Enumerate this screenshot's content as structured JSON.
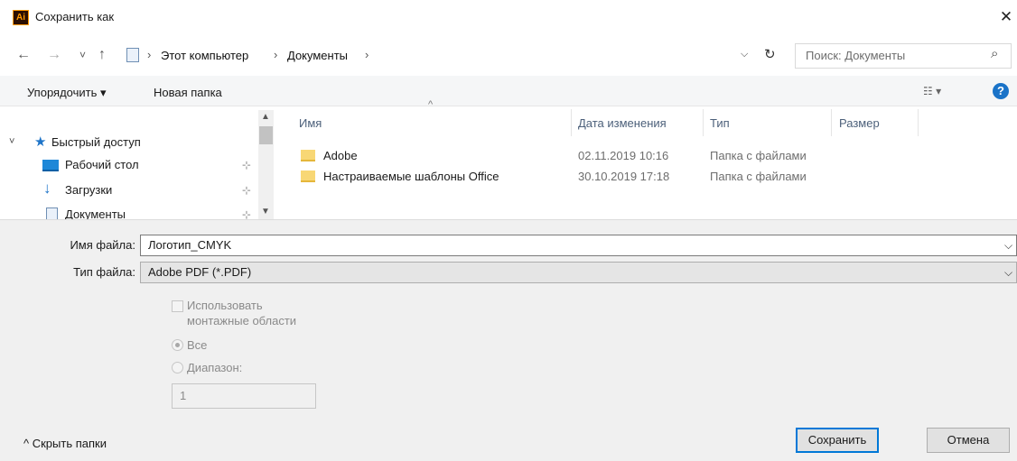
{
  "window": {
    "app_icon_text": "Ai",
    "title": "Сохранить как",
    "close_glyph": "✕"
  },
  "nav": {
    "back_glyph": "←",
    "forward_glyph": "→",
    "recent_glyph": "˅",
    "up_glyph": "↑",
    "breadcrumb": [
      "Этот компьютер",
      "Документы"
    ],
    "separator": "›",
    "refresh_glyph": "↻",
    "search_placeholder": "Поиск: Документы",
    "search_glyph": "⌕"
  },
  "toolbar": {
    "organize_label": "Упорядочить ▾",
    "new_folder_label": "Новая папка",
    "view_glyph": "☷ ▾",
    "help_glyph": "?"
  },
  "sidebar": {
    "items": [
      {
        "label": "Быстрый доступ",
        "icon": "star-icon",
        "pinned": false
      },
      {
        "label": "Рабочий стол",
        "icon": "desktop-icon",
        "pinned": true
      },
      {
        "label": "Загрузки",
        "icon": "download-icon",
        "pinned": true
      },
      {
        "label": "Документы",
        "icon": "documents-icon",
        "pinned": true
      }
    ],
    "pin_glyph": "📌"
  },
  "file_list": {
    "sort_glyph": "^",
    "columns": [
      "Имя",
      "Дата изменения",
      "Тип",
      "Размер"
    ],
    "rows": [
      {
        "name": "Adobe",
        "date": "02.11.2019 10:16",
        "type": "Папка с файлами",
        "size": ""
      },
      {
        "name": "Настраиваемые шаблоны Office",
        "date": "30.10.2019 17:18",
        "type": "Папка с файлами",
        "size": ""
      }
    ]
  },
  "form": {
    "file_name_label": "Имя файла:",
    "file_name_value": "Логотип_CMYK",
    "file_type_label": "Тип файла:",
    "file_type_value": "Adobe PDF (*.PDF)",
    "chevron": "⌵",
    "artboards_line1": "Использовать",
    "artboards_line2": "монтажные области",
    "radio_all": "Все",
    "radio_range": "Диапазон:",
    "range_value": "1"
  },
  "footer": {
    "hide_folders": "^ Скрыть папки",
    "save_label": "Сохранить",
    "cancel_label": "Отмена"
  }
}
